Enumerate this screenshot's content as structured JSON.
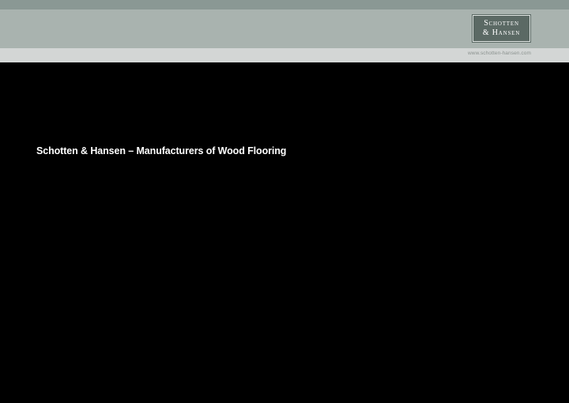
{
  "header": {
    "logo_line_1": "Schotten",
    "logo_line_2": "& Hansen",
    "url": "www.schotten-hansen.com"
  },
  "main": {
    "headline": "Schotten & Hansen – Manufacturers of Wood Flooring"
  },
  "colors": {
    "background": "#000000",
    "top_strip": "#8a9894",
    "header_band": "#a9b3af",
    "url_bar": "#d3d6d5",
    "logo_box": "#5b6964"
  }
}
